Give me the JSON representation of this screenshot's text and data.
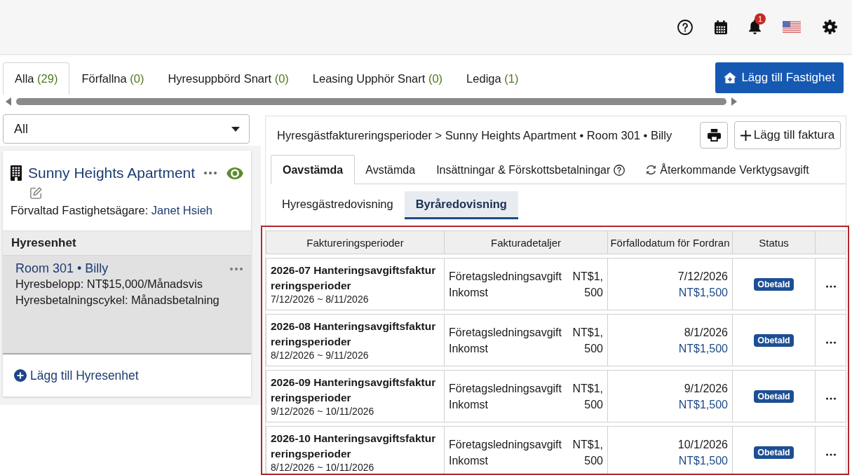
{
  "header": {
    "notifications": "1"
  },
  "filter_tabs": [
    {
      "label": "Alla",
      "count": "(29)",
      "selected": true
    },
    {
      "label": "Förfallna",
      "count": "(0)",
      "selected": false
    },
    {
      "label": "Hyresuppbörd Snart",
      "count": "(0)",
      "selected": false
    },
    {
      "label": "Leasing Upphör Snart",
      "count": "(0)",
      "selected": false
    },
    {
      "label": "Lediga",
      "count": "(1)",
      "selected": false
    }
  ],
  "add_property_button": "Lägg till Fastighet",
  "property_filter": {
    "value": "All"
  },
  "property": {
    "name": "Sunny Heights Apartment",
    "owner_label": "Förvaltad Fastighetsägare:",
    "owner": "Janet Hsieh"
  },
  "units": {
    "heading": "Hyresenhet",
    "items": [
      {
        "title": "Room 301 • Billy",
        "rent": "Hyresbelopp: NT$15,000/Månadsvis",
        "cycle": "Hyresbetalningscykel: Månadsbetalning",
        "selected": true
      }
    ],
    "add_button": "Lägg till Hyresenhet"
  },
  "detail": {
    "breadcrumb": "Hyresgästfaktureringsperioder > Sunny Heights Apartment • Room 301 • Billy",
    "add_invoice_button": "Lägg till faktura",
    "tabs": [
      {
        "label": "Oavstämda",
        "kind": "plain",
        "selected": true
      },
      {
        "label": "Avstämda",
        "kind": "plain",
        "selected": false
      },
      {
        "label": "Insättningar & Förskottsbetalningar",
        "kind": "help",
        "selected": false
      },
      {
        "label": "Återkommande Verktygsavgift",
        "kind": "recurring",
        "selected": false
      }
    ],
    "subtabs": [
      {
        "label": "Hyresgästredovisning",
        "selected": false
      },
      {
        "label": "Byråredovisning",
        "selected": true
      }
    ],
    "table": {
      "columns": [
        "Faktureringsperioder",
        "Fakturadetaljer",
        "Förfallodatum för Fordran",
        "Status"
      ],
      "rows": [
        {
          "period": "2026-07 Hanteringsavgiftsfaktur reringsperioder",
          "dates": "7/12/2026 ~ 8/11/2026",
          "fee": "Företagsledningsavgift",
          "fee_type": "Inkomst",
          "amount": "NT$1,500",
          "due_date": "7/12/2026",
          "due_amount": "NT$1,500",
          "status": "Obetald"
        },
        {
          "period": "2026-08 Hanteringsavgiftsfaktur reringsperioder",
          "dates": "8/12/2026 ~ 9/11/2026",
          "fee": "Företagsledningsavgift",
          "fee_type": "Inkomst",
          "amount": "NT$1,500",
          "due_date": "8/1/2026",
          "due_amount": "NT$1,500",
          "status": "Obetald"
        },
        {
          "period": "2026-09 Hanteringsavgiftsfaktur reringsperioder",
          "dates": "9/12/2026 ~ 10/11/2026",
          "fee": "Företagsledningsavgift",
          "fee_type": "Inkomst",
          "amount": "NT$1,500",
          "due_date": "9/1/2026",
          "due_amount": "NT$1,500",
          "status": "Obetald"
        },
        {
          "period": "2026-10 Hanteringsavgiftsfaktur reringsperioder",
          "dates": "8/12/2026 ~ 10/11/2026",
          "fee": "Företagsledningsavgift",
          "fee_type": "Inkomst",
          "amount": "NT$1,500",
          "due_date": "10/1/2026",
          "due_amount": "NT$1,500",
          "status": "Obetald"
        }
      ]
    }
  }
}
